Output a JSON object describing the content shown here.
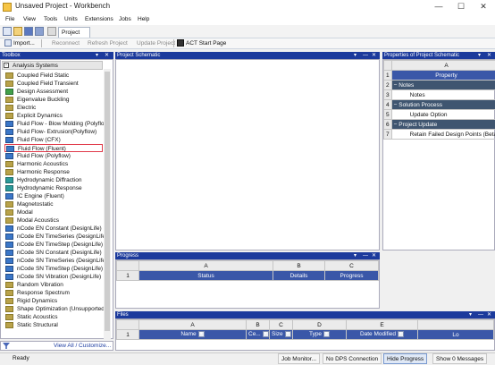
{
  "window": {
    "title": "Unsaved Project - Workbench",
    "controls": {
      "minimize": "—",
      "maximize": "☐",
      "close": "✕"
    }
  },
  "menu": [
    "File",
    "View",
    "Tools",
    "Units",
    "Extensions",
    "Jobs",
    "Help"
  ],
  "tabs": {
    "project": "Project"
  },
  "actions": {
    "import": "Import...",
    "reconnect": "Reconnect",
    "refresh": "Refresh Project",
    "update": "Update Project",
    "act_start": "ACT Start Page"
  },
  "toolbox": {
    "title": "Toolbox",
    "category": "Analysis Systems",
    "items": [
      {
        "label": "Coupled Field Static",
        "icon": "bar"
      },
      {
        "label": "Coupled Field Transient",
        "icon": "bar"
      },
      {
        "label": "Design Assessment",
        "icon": "green"
      },
      {
        "label": "Eigenvalue Buckling",
        "icon": "bar"
      },
      {
        "label": "Electric",
        "icon": "bar"
      },
      {
        "label": "Explicit Dynamics",
        "icon": "bar"
      },
      {
        "label": "Fluid Flow - Blow Molding (Polyflow)",
        "icon": "blue"
      },
      {
        "label": "Fluid Flow- Extrusion(Polyflow)",
        "icon": "blue"
      },
      {
        "label": "Fluid Flow (CFX)",
        "icon": "blue"
      },
      {
        "label": "Fluid Flow (Fluent)",
        "icon": "blue"
      },
      {
        "label": "Fluid Flow (Polyflow)",
        "icon": "blue"
      },
      {
        "label": "Harmonic Acoustics",
        "icon": "bar"
      },
      {
        "label": "Harmonic Response",
        "icon": "bar"
      },
      {
        "label": "Hydrodynamic Diffraction",
        "icon": "teal"
      },
      {
        "label": "Hydrodynamic Response",
        "icon": "teal"
      },
      {
        "label": "IC Engine (Fluent)",
        "icon": "blue"
      },
      {
        "label": "Magnetostatic",
        "icon": "bar"
      },
      {
        "label": "Modal",
        "icon": "bar"
      },
      {
        "label": "Modal Acoustics",
        "icon": "bar"
      },
      {
        "label": "nCode EN Constant (DesignLife)",
        "icon": "blue"
      },
      {
        "label": "nCode EN TimeSeries (DesignLife)",
        "icon": "blue"
      },
      {
        "label": "nCode EN TimeStep (DesignLife)",
        "icon": "blue"
      },
      {
        "label": "nCode SN Constant (DesignLife)",
        "icon": "blue"
      },
      {
        "label": "nCode SN TimeSeries (DesignLife)",
        "icon": "blue"
      },
      {
        "label": "nCode SN TimeStep (DesignLife)",
        "icon": "blue"
      },
      {
        "label": "nCode SN Vibration (DesignLife)",
        "icon": "blue"
      },
      {
        "label": "Random Vibration",
        "icon": "bar"
      },
      {
        "label": "Response Spectrum",
        "icon": "bar"
      },
      {
        "label": "Rigid Dynamics",
        "icon": "bar"
      },
      {
        "label": "Shape Optimization (Unsupported)",
        "icon": "bar"
      },
      {
        "label": "Static Acoustics",
        "icon": "bar"
      },
      {
        "label": "Static Structural",
        "icon": "bar"
      }
    ],
    "selected_index": 9,
    "view_all": "View All / Customize..."
  },
  "schematic": {
    "title": "Project Schematic"
  },
  "properties": {
    "title": "Properties of Project Schematic",
    "col_letter": "A",
    "col_header": "Property",
    "rows": [
      {
        "num": "1",
        "text": "Property",
        "kind": "header"
      },
      {
        "num": "2",
        "text": "Notes",
        "kind": "section"
      },
      {
        "num": "3",
        "text": "Notes",
        "kind": "item"
      },
      {
        "num": "4",
        "text": "Solution Process",
        "kind": "section"
      },
      {
        "num": "5",
        "text": "Update Option",
        "kind": "item"
      },
      {
        "num": "6",
        "text": "Project Update",
        "kind": "section"
      },
      {
        "num": "7",
        "text": "Retain Failed Design Points (Beta)",
        "kind": "item"
      }
    ]
  },
  "progress": {
    "title": "Progress",
    "col_letters": [
      "A",
      "B",
      "C"
    ],
    "headers": [
      "Status",
      "Details",
      "Progress"
    ],
    "row_num": "1"
  },
  "files": {
    "title": "Files",
    "col_letters": [
      "A",
      "B",
      "C",
      "D",
      "E"
    ],
    "headers": [
      "Name",
      "Ce...",
      "Size",
      "Type",
      "Date Modified",
      "Lo"
    ],
    "row_num": "1"
  },
  "status": {
    "ready": "Ready",
    "job_monitor": "Job Monitor...",
    "dps": "No DPS Connection",
    "hide_progress": "Hide Progress",
    "messages": "Show 0 Messages"
  },
  "panel_controls": {
    "pin": "▾",
    "pin2": "—",
    "close": "✕"
  }
}
